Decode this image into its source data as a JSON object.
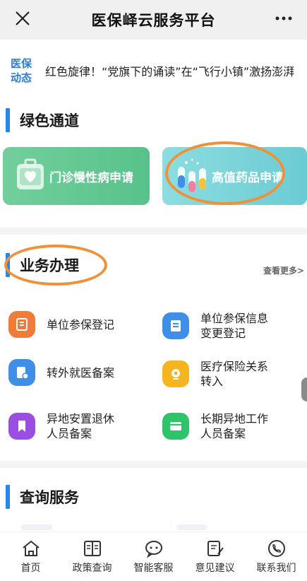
{
  "nav": {
    "title": "医保峄云服务平台"
  },
  "news": {
    "tag_line1": "医保",
    "tag_line2": "动态",
    "headline": "红色旋律！“党旗下的诵读”在“飞行小镇”激扬澎湃"
  },
  "green_channel": {
    "title": "绿色通道",
    "cards": [
      {
        "label": "门诊慢性病申请"
      },
      {
        "label": "高值药品申请"
      }
    ]
  },
  "business": {
    "title": "业务办理",
    "more_label": "查看更多>",
    "items": [
      {
        "label": "单位参保登记",
        "icon": "building-icon",
        "color": "#f07b3a"
      },
      {
        "label": "单位参保信息\n变更登记",
        "icon": "document-icon",
        "color": "#3f8ee8"
      },
      {
        "label": "转外就医备案",
        "icon": "transfer-icon",
        "color": "#3f8ee8"
      },
      {
        "label": "医疗保险关系\n转入",
        "icon": "camera-icon",
        "color": "#f5b51e"
      },
      {
        "label": "异地安置退休\n人员备案",
        "icon": "bookmark-icon",
        "color": "#9b4fe0"
      },
      {
        "label": "长期异地工作\n人员备案",
        "icon": "card-icon",
        "color": "#2fc46a"
      }
    ]
  },
  "query": {
    "title": "查询服务"
  },
  "tabbar": [
    {
      "label": "首页",
      "icon": "home-icon"
    },
    {
      "label": "政策查询",
      "icon": "book-icon"
    },
    {
      "label": "智能客服",
      "icon": "chat-icon"
    },
    {
      "label": "意见建议",
      "icon": "edit-icon"
    },
    {
      "label": "联系我们",
      "icon": "phone-icon"
    }
  ]
}
